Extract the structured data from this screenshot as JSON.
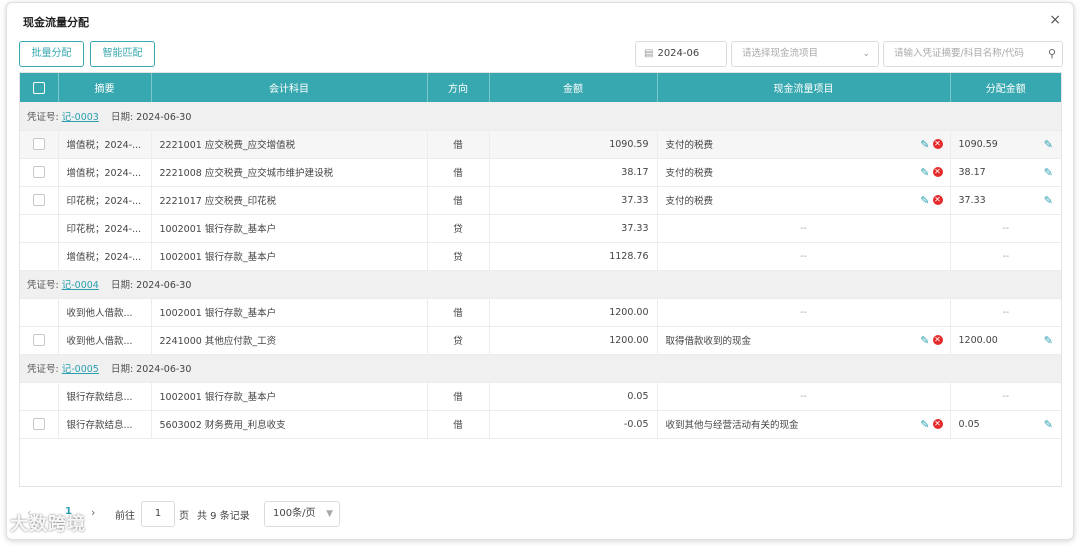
{
  "dialog": {
    "title": "现金流量分配",
    "close_label": "×"
  },
  "toolbar": {
    "batch_label": "批量分配",
    "smart_label": "智能匹配",
    "date_value": "2024-06",
    "cashflow_placeholder": "请选择现金流项目",
    "search_placeholder": "请输入凭证摘要/科目名称/代码"
  },
  "table": {
    "headers": [
      "摘要",
      "会计科目",
      "方向",
      "金额",
      "现金流量项目",
      "分配金额"
    ],
    "voucher_label": "凭证号:",
    "date_label": "日期:",
    "groups": [
      {
        "voucher": "记-0003",
        "date": "2024-06-30",
        "rows": [
          {
            "check": true,
            "summary": "增值税；2024-...",
            "account": "2221001 应交税费_应交增值税",
            "dir": "借",
            "amount": "1090.59",
            "cf": "支付的税费",
            "alloc": "1090.59",
            "editable": true
          },
          {
            "check": true,
            "summary": "增值税；2024-...",
            "account": "2221008 应交税费_应交城市维护建设税",
            "dir": "借",
            "amount": "38.17",
            "cf": "支付的税费",
            "alloc": "38.17",
            "editable": true
          },
          {
            "check": true,
            "summary": "印花税；2024-...",
            "account": "2221017 应交税费_印花税",
            "dir": "借",
            "amount": "37.33",
            "cf": "支付的税费",
            "alloc": "37.33",
            "editable": true
          },
          {
            "check": false,
            "summary": "印花税；2024-...",
            "account": "1002001 银行存款_基本户",
            "dir": "贷",
            "amount": "37.33",
            "cf": "--",
            "alloc": "--",
            "editable": false
          },
          {
            "check": false,
            "summary": "增值税；2024-...",
            "account": "1002001 银行存款_基本户",
            "dir": "贷",
            "amount": "1128.76",
            "cf": "--",
            "alloc": "--",
            "editable": false
          }
        ]
      },
      {
        "voucher": "记-0004",
        "date": "2024-06-30",
        "rows": [
          {
            "check": false,
            "summary": "收到他人借款...",
            "account": "1002001 银行存款_基本户",
            "dir": "借",
            "amount": "1200.00",
            "cf": "--",
            "alloc": "--",
            "editable": false
          },
          {
            "check": true,
            "summary": "收到他人借款...",
            "account": "2241000 其他应付款_工资",
            "dir": "贷",
            "amount": "1200.00",
            "cf": "取得借款收到的现金",
            "alloc": "1200.00",
            "editable": true
          }
        ]
      },
      {
        "voucher": "记-0005",
        "date": "2024-06-30",
        "rows": [
          {
            "check": false,
            "summary": "银行存款结息...",
            "account": "1002001 银行存款_基本户",
            "dir": "借",
            "amount": "0.05",
            "cf": "--",
            "alloc": "--",
            "editable": false
          },
          {
            "check": true,
            "summary": "银行存款结息...",
            "account": "5603002 财务费用_利息收支",
            "dir": "借",
            "amount": "-0.05",
            "cf": "收到其他与经营活动有关的现金",
            "alloc": "0.05",
            "editable": true
          }
        ]
      }
    ]
  },
  "pagination": {
    "prev": "‹",
    "current_page": "1",
    "next": "›",
    "goto_label": "前往",
    "goto_value": "1",
    "page_word": "页",
    "total_text": "共 9 条记录",
    "page_size": "100条/页"
  },
  "watermark": "大数跨境",
  "colors": {
    "accent": "#38a8b0",
    "link": "#2a9fb0",
    "delete": "#e32b2b"
  },
  "icons": [
    "close-icon",
    "calendar-icon",
    "chevron-down-icon",
    "search-icon",
    "edit-icon",
    "delete-icon",
    "chevron-left-icon",
    "chevron-right-icon"
  ]
}
